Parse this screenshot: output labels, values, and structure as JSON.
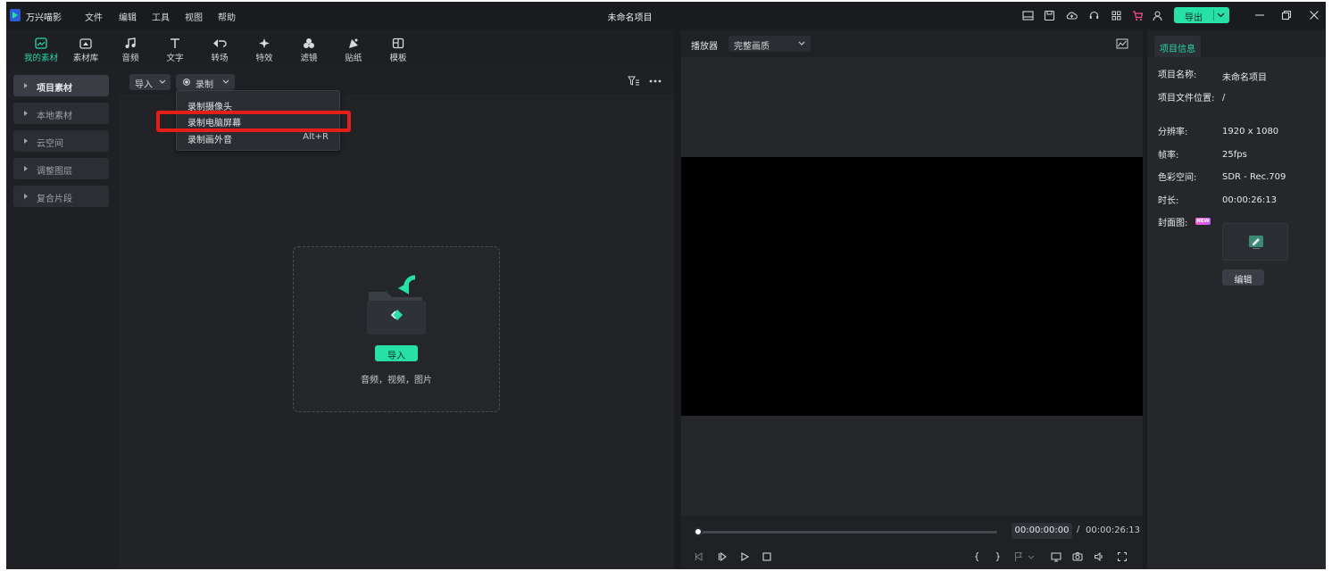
{
  "app": {
    "name": "万兴喵影",
    "window_title": "未命名项目"
  },
  "menu": [
    "文件",
    "编辑",
    "工具",
    "视图",
    "帮助"
  ],
  "titlebar": {
    "export_label": "导出"
  },
  "colors": {
    "accent": "#27e0a6",
    "highlight": "#e41f1a",
    "panel": "#202226",
    "video_bg": "#000000"
  },
  "toolbar": {
    "items": [
      {
        "label": "我的素材",
        "icon": "my-media-icon",
        "active": true
      },
      {
        "label": "素材库",
        "icon": "stock-media-icon"
      },
      {
        "label": "音频",
        "icon": "music-note-icon"
      },
      {
        "label": "文字",
        "icon": "text-t-icon"
      },
      {
        "label": "转场",
        "icon": "transition-icon"
      },
      {
        "label": "特效",
        "icon": "effects-sparkle-icon"
      },
      {
        "label": "滤镜",
        "icon": "filter-circles-icon"
      },
      {
        "label": "贴纸",
        "icon": "sticker-icon"
      },
      {
        "label": "模板",
        "icon": "template-icon"
      }
    ]
  },
  "sidebar": {
    "items": [
      {
        "label": "项目素材",
        "active": true
      },
      {
        "label": "本地素材"
      },
      {
        "label": "云空间"
      },
      {
        "label": "调整图层"
      },
      {
        "label": "复合片段"
      }
    ]
  },
  "subbar": {
    "import_label": "导入",
    "record_label": "录制"
  },
  "record_menu": {
    "items": [
      {
        "label": "录制摄像头",
        "shortcut": ""
      },
      {
        "label": "录制电脑屏幕",
        "shortcut": "",
        "highlighted": true
      },
      {
        "label": "录制画外音",
        "shortcut": "Alt+R"
      }
    ]
  },
  "drop_zone": {
    "import_label": "导入",
    "hint": "音频，视频，图片"
  },
  "player": {
    "label": "播放器",
    "quality": "完整画质",
    "current_time": "00:00:00:00",
    "separator": "/",
    "total_time": "00:00:26:13",
    "progress": 0
  },
  "project_info": {
    "tab_label": "项目信息",
    "fields": [
      {
        "label": "项目名称:",
        "value": "未命名项目"
      },
      {
        "label": "项目文件位置:",
        "value": "/"
      },
      {
        "label": "分辨率:",
        "value": "1920 x 1080"
      },
      {
        "label": "帧率:",
        "value": "25fps"
      },
      {
        "label": "色彩空间:",
        "value": "SDR - Rec.709"
      },
      {
        "label": "时长:",
        "value": "00:00:26:13"
      }
    ],
    "cover_label": "封面图:",
    "new_badge": "NEW",
    "edit_label": "编辑"
  }
}
